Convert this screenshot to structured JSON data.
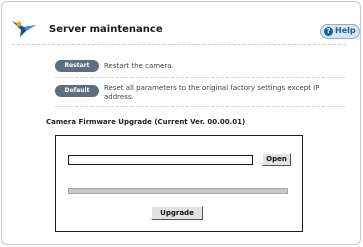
{
  "header": {
    "title": "Server maintenance",
    "help_label": "Help"
  },
  "actions": [
    {
      "button": "Restart",
      "description": "Restart the camera."
    },
    {
      "button": "Default",
      "description": "Reset all parameters to the original factory settings except IP address."
    }
  ],
  "firmware": {
    "section_title": "Camera Firmware Upgrade (Current Ver. 00.00.01)",
    "file_value": "",
    "open_label": "Open",
    "upgrade_label": "Upgrade",
    "progress": 0
  }
}
